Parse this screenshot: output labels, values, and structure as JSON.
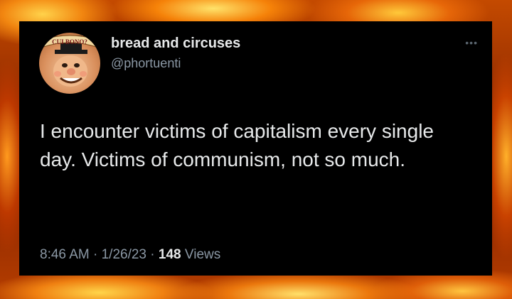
{
  "tweet": {
    "avatar_badge_text": "CUI BONO?",
    "display_name": "bread and circuses",
    "handle": "@phortuenti",
    "more_icon": "more-dots-icon",
    "text": "I encounter victims of capitalism every single day. Victims of communism, not so much.",
    "time": "8:46 AM",
    "date": "1/26/23",
    "views_count": "148",
    "views_label": "Views",
    "separator": "·"
  },
  "colors": {
    "card_bg": "#000000",
    "primary_text": "#e7e9ea",
    "secondary_text": "#8b98a5",
    "flame_orange": "#ff8a1a",
    "flame_yellow": "#ffd24a"
  }
}
